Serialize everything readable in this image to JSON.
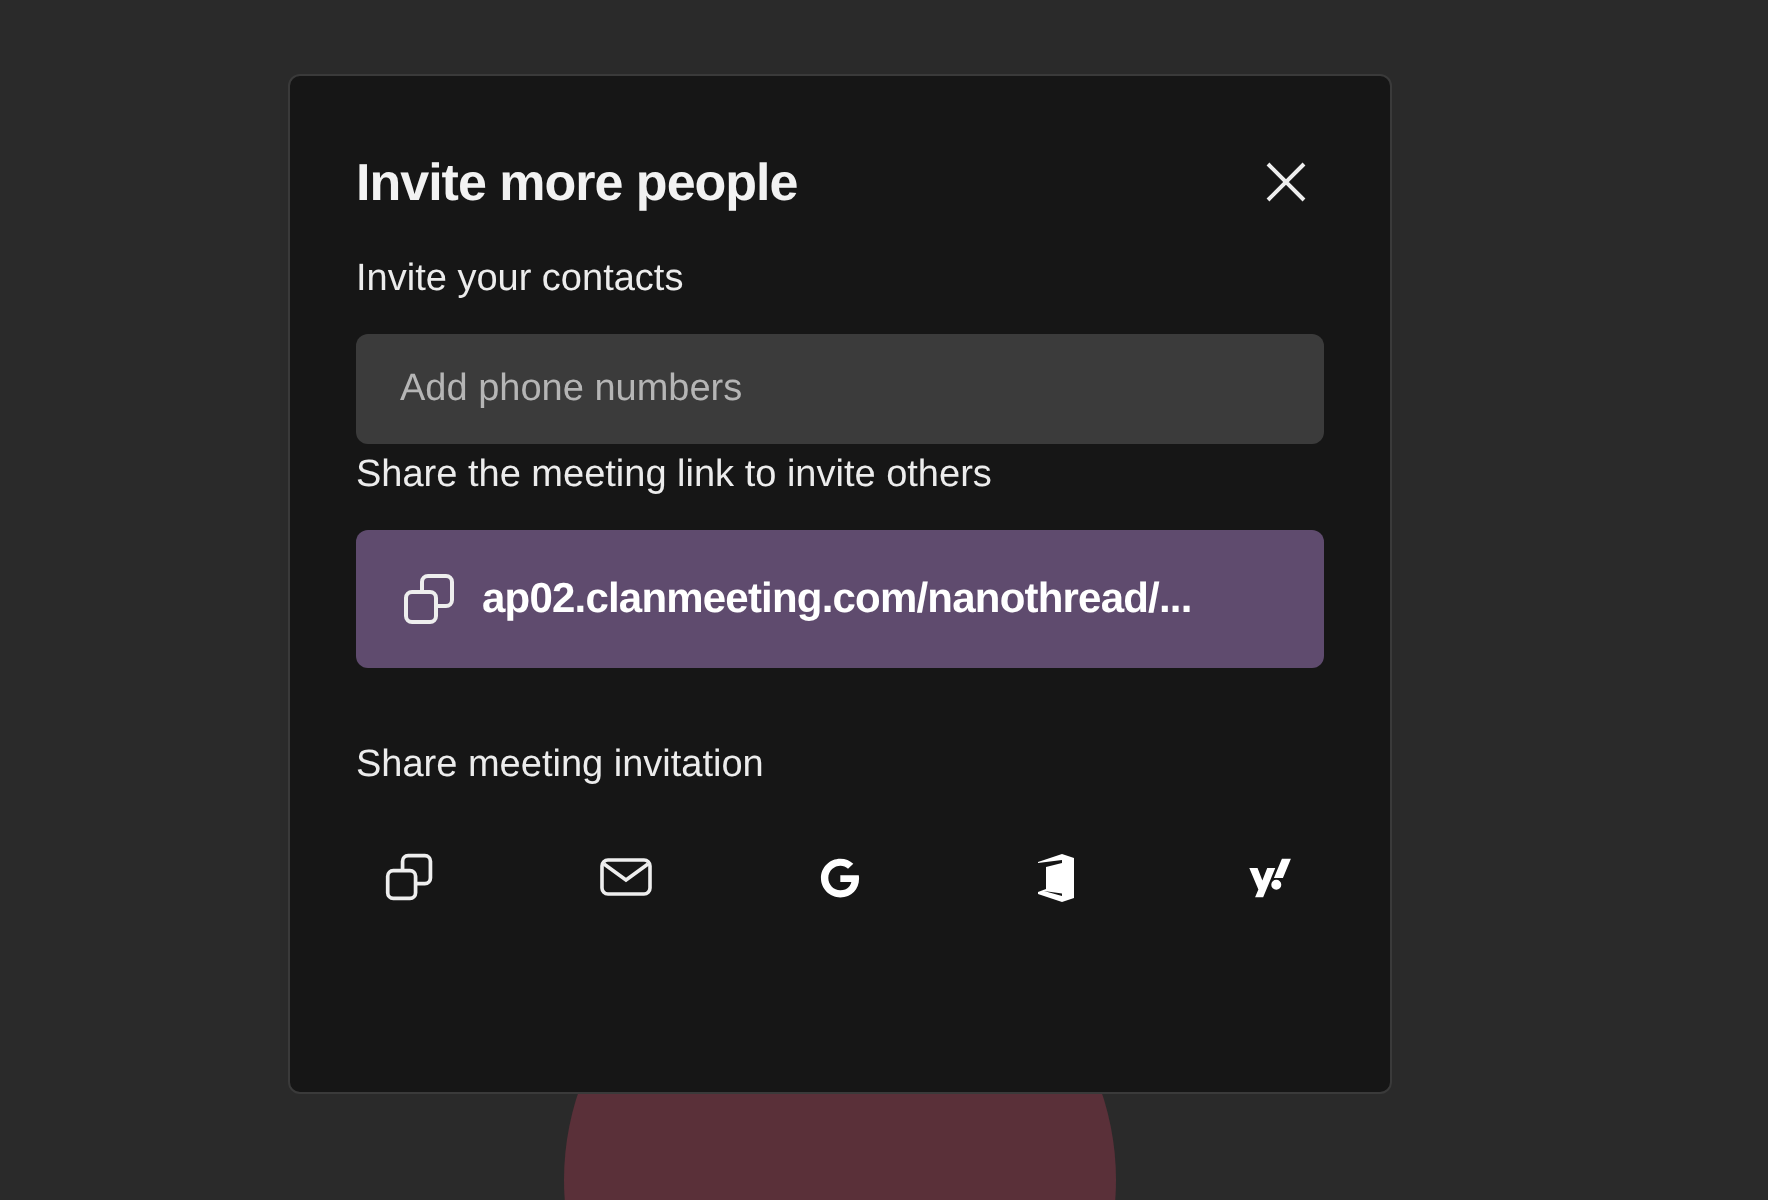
{
  "dialog": {
    "title": "Invite more people",
    "contacts": {
      "label": "Invite your contacts",
      "placeholder": "Add phone numbers"
    },
    "link": {
      "label": "Share the meeting link to invite others",
      "url": "ap02.clanmeeting.com/nanothread/..."
    },
    "share": {
      "label": "Share meeting invitation",
      "options": [
        {
          "kind": "copy"
        },
        {
          "kind": "mail"
        },
        {
          "kind": "google"
        },
        {
          "kind": "office"
        },
        {
          "kind": "yahoo"
        }
      ]
    }
  }
}
